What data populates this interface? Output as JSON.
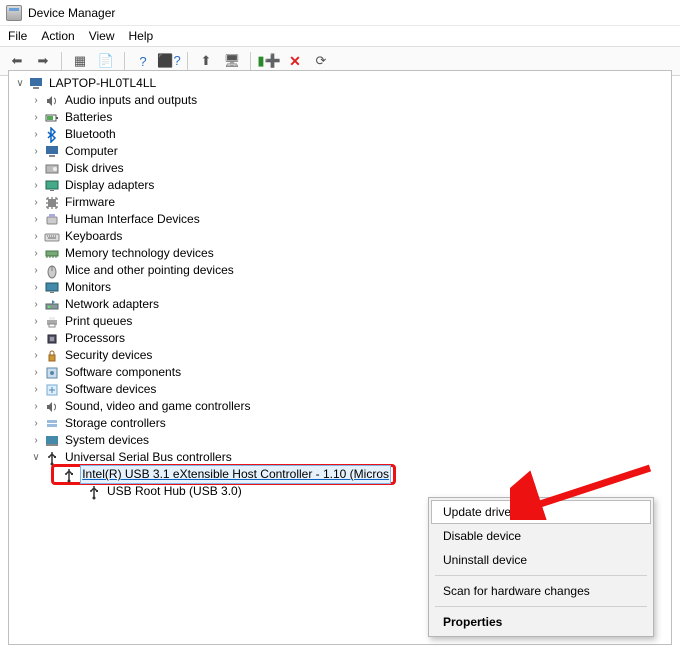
{
  "window": {
    "title": "Device Manager"
  },
  "menu": {
    "file": "File",
    "action": "Action",
    "view": "View",
    "help": "Help"
  },
  "toolbar_icons": {
    "back": "back-arrow",
    "forward": "forward-arrow",
    "show_hidden": "show-hidden",
    "print": "properties",
    "help1": "help",
    "help2": "help-topics",
    "monitor": "monitor",
    "plus": "update",
    "green": "scan",
    "red_x": "remove",
    "refresh": "refresh"
  },
  "tree": {
    "root": "LAPTOP-HL0TL4LL",
    "categories": [
      {
        "label": "Audio inputs and outputs",
        "icon": "speaker"
      },
      {
        "label": "Batteries",
        "icon": "battery"
      },
      {
        "label": "Bluetooth",
        "icon": "bluetooth"
      },
      {
        "label": "Computer",
        "icon": "pc"
      },
      {
        "label": "Disk drives",
        "icon": "disk"
      },
      {
        "label": "Display adapters",
        "icon": "display"
      },
      {
        "label": "Firmware",
        "icon": "chip"
      },
      {
        "label": "Human Interface Devices",
        "icon": "hid"
      },
      {
        "label": "Keyboards",
        "icon": "keyboard"
      },
      {
        "label": "Memory technology devices",
        "icon": "memory"
      },
      {
        "label": "Mice and other pointing devices",
        "icon": "mouse"
      },
      {
        "label": "Monitors",
        "icon": "monitor"
      },
      {
        "label": "Network adapters",
        "icon": "network"
      },
      {
        "label": "Print queues",
        "icon": "printer"
      },
      {
        "label": "Processors",
        "icon": "cpu"
      },
      {
        "label": "Security devices",
        "icon": "security"
      },
      {
        "label": "Software components",
        "icon": "component"
      },
      {
        "label": "Software devices",
        "icon": "softdev"
      },
      {
        "label": "Sound, video and game controllers",
        "icon": "speaker"
      },
      {
        "label": "Storage controllers",
        "icon": "storage"
      },
      {
        "label": "System devices",
        "icon": "system"
      },
      {
        "label": "Universal Serial Bus controllers",
        "icon": "usb",
        "expanded": true,
        "children": [
          {
            "label": "Intel(R) USB 3.1 eXtensible Host Controller - 1.10 (Micros",
            "highlighted": true
          },
          {
            "label": "USB Root Hub (USB 3.0)"
          }
        ]
      }
    ]
  },
  "context_menu": {
    "update": "Update driver",
    "disable": "Disable device",
    "uninstall": "Uninstall device",
    "scan": "Scan for hardware changes",
    "properties": "Properties"
  }
}
